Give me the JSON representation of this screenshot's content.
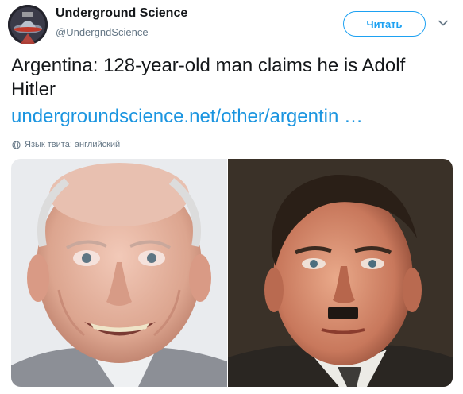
{
  "account": {
    "display_name": "Underground Science",
    "handle": "@UndergndScience",
    "avatar_icon": "ufo-avatar-icon"
  },
  "header": {
    "follow_label": "Читать",
    "menu_icon": "chevron-down-icon"
  },
  "tweet": {
    "text": "Argentina: 128-year-old man claims he is Adolf Hitler",
    "link": "undergroundscience.net/other/argentin …",
    "language_note": "Язык твита: английский",
    "language_icon": "globe-icon"
  },
  "media": {
    "left_photo": "elderly-man-photo",
    "right_photo": "portrait-photo"
  },
  "colors": {
    "accent": "#1da1f2",
    "link": "#1b95e0",
    "text": "#14171a",
    "muted": "#657786"
  }
}
